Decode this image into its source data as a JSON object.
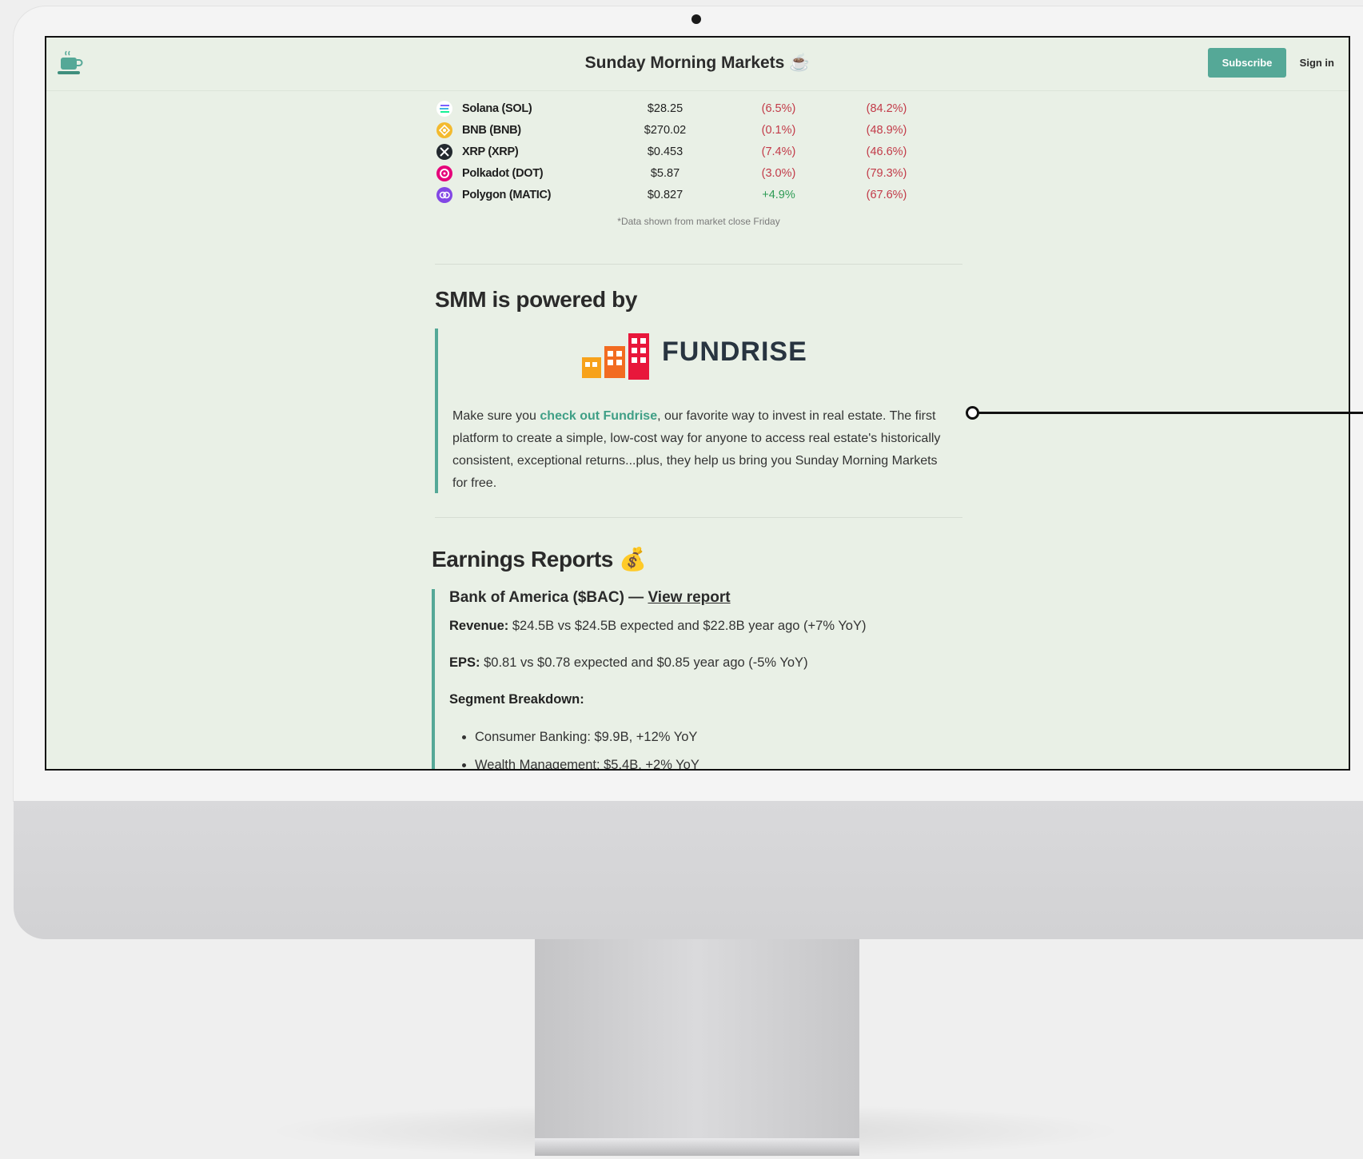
{
  "header": {
    "title": "Sunday Morning Markets ☕",
    "subscribe_label": "Subscribe",
    "signin_label": "Sign in"
  },
  "crypto": {
    "rows": [
      {
        "name": "Solana (SOL)",
        "price": "$28.25",
        "week": "(6.5%)",
        "ytd": "(84.2%)",
        "icon": "solana-icon",
        "color": "#6c5ce7"
      },
      {
        "name": "BNB (BNB)",
        "price": "$270.02",
        "week": "(0.1%)",
        "ytd": "(48.9%)",
        "icon": "bnb-icon",
        "color": "#f3ba2f"
      },
      {
        "name": "XRP (XRP)",
        "price": "$0.453",
        "week": "(7.4%)",
        "ytd": "(46.6%)",
        "icon": "xrp-icon",
        "color": "#23292f"
      },
      {
        "name": "Polkadot (DOT)",
        "price": "$5.87",
        "week": "(3.0%)",
        "ytd": "(79.3%)",
        "icon": "polkadot-icon",
        "color": "#e6007a"
      },
      {
        "name": "Polygon (MATIC)",
        "price": "$0.827",
        "week": "+4.9%",
        "ytd": "(67.6%)",
        "icon": "polygon-icon",
        "color": "#8247e5"
      }
    ],
    "footnote": "*Data shown from market close Friday"
  },
  "sponsor": {
    "title": "SMM is powered by",
    "brand": "FUNDRISE",
    "text_before": "Make sure you ",
    "link_text": "check out Fundrise",
    "text_after": ", our favorite way to invest in real estate. The first platform to create a simple, low-cost way for anyone to access real estate's historically consistent, exceptional returns...plus, they help us bring you Sunday Morning Markets for free."
  },
  "earnings": {
    "title": "Earnings Reports 💰",
    "company": "Bank of America ($BAC) — ",
    "report_link": "View report",
    "revenue_label": "Revenue:",
    "revenue_text": " $24.5B vs $24.5B expected and $22.8B year ago (+7% YoY)",
    "eps_label": "EPS:",
    "eps_text": " $0.81 vs $0.78 expected and $0.85 year ago (-5% YoY)",
    "segment_label": "Segment Breakdown:",
    "segments": [
      "Consumer Banking: $9.9B, +12% YoY",
      "Wealth Management: $5.4B, +2% YoY"
    ]
  },
  "colors": {
    "accent": "#55a897",
    "negative": "#c23a48",
    "positive": "#2e9b55",
    "screen_bg": "#e9f0e6"
  }
}
